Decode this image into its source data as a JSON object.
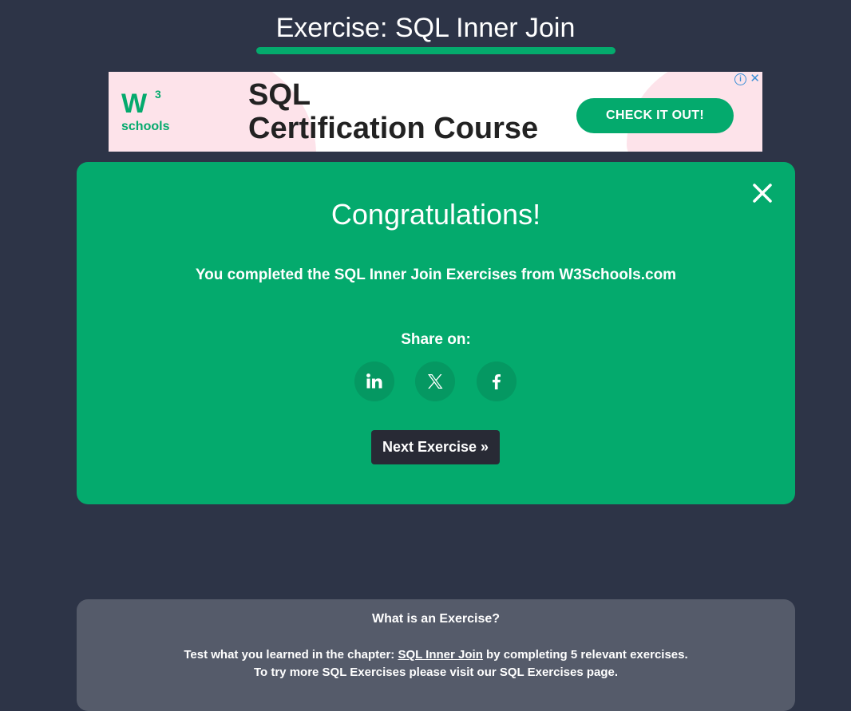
{
  "header": {
    "title": "Exercise: SQL Inner Join"
  },
  "ad": {
    "logo_w3": "W",
    "logo_sup": "3",
    "logo_schools": "schools",
    "headline_line1": "SQL",
    "headline_line2": "Certification Course",
    "cta_label": "CHECK IT OUT!",
    "info_label": "i",
    "close_label": "✕"
  },
  "congrats": {
    "heading": "Congratulations!",
    "message": "You completed the SQL Inner Join Exercises from W3Schools.com",
    "share_label": "Share on:",
    "share_buttons": [
      {
        "icon": "linkedin-icon",
        "glyph": "in"
      },
      {
        "icon": "x-icon",
        "glyph": "𝕏"
      },
      {
        "icon": "facebook-icon",
        "glyph": "f"
      }
    ],
    "next_label": "Next Exercise »",
    "close_icon": "close-icon"
  },
  "info": {
    "heading": "What is an Exercise?",
    "line1_prefix": "Test what you learned in the chapter: ",
    "line1_link": "SQL Inner Join",
    "line1_suffix": " by completing 5 relevant exercises.",
    "line2": "To try more SQL Exercises please visit our SQL Exercises page."
  },
  "colors": {
    "background": "#2d3447",
    "accent": "#04aa6d",
    "button_dark": "#282a35",
    "info_panel": "#555b6a"
  }
}
